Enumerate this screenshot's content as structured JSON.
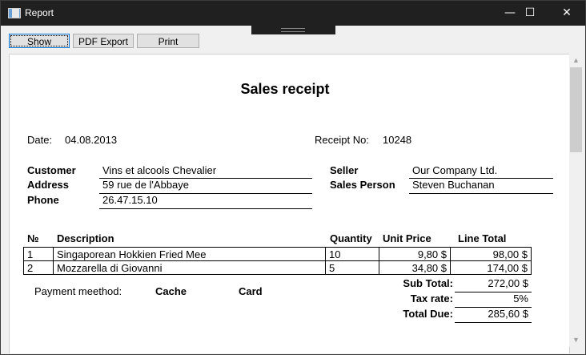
{
  "window": {
    "title": "Report"
  },
  "toolbar": {
    "show": "Show",
    "pdf_export": "PDF Export",
    "print": "Print"
  },
  "report": {
    "title": "Sales receipt",
    "date_label": "Date:",
    "date_value": "04.08.2013",
    "receipt_label": "Receipt No:",
    "receipt_value": "10248",
    "customer_label": "Customer",
    "customer_value": "Vins et alcools Chevalier",
    "address_label": "Address",
    "address_value": "59 rue de l'Abbaye",
    "phone_label": "Phone",
    "phone_value": "26.47.15.10",
    "seller_label": "Seller",
    "seller_value": "Our Company Ltd.",
    "salesperson_label": "Sales Person",
    "salesperson_value": "Steven Buchanan",
    "columns": {
      "no": "№",
      "description": "Description",
      "quantity": "Quantity",
      "unit_price": "Unit Price",
      "line_total": "Line Total"
    },
    "rows": [
      {
        "no": "1",
        "description": "Singaporean Hokkien Fried Mee",
        "quantity": "10",
        "unit_price": "9,80 $",
        "line_total": "98,00 $"
      },
      {
        "no": "2",
        "description": "Mozzarella di Giovanni",
        "quantity": "5",
        "unit_price": "34,80 $",
        "line_total": "174,00 $"
      }
    ],
    "payment_label": "Payment meethod:",
    "payment_cache": "Cache",
    "payment_card": "Card",
    "subtotal_label": "Sub Total:",
    "subtotal_value": "272,00 $",
    "taxrate_label": "Tax rate:",
    "taxrate_value": "5%",
    "totaldue_label": "Total Due:",
    "totaldue_value": "285,60 $"
  },
  "icons": {
    "app": "app-window-icon",
    "minimize": "minimize-icon",
    "maximize": "maximize-icon",
    "close": "close-icon"
  }
}
